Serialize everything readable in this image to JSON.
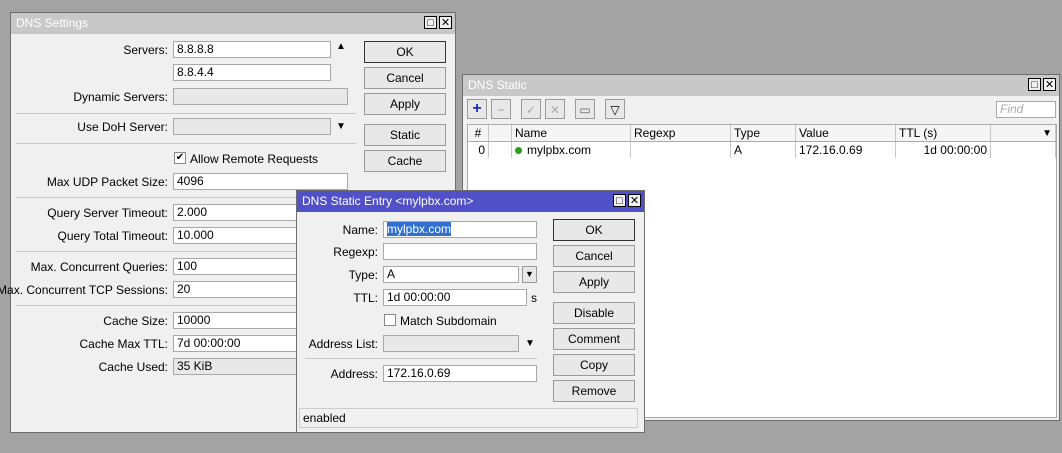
{
  "settings": {
    "title": "DNS Settings",
    "labels": {
      "servers": "Servers:",
      "dynamic": "Dynamic Servers:",
      "doh": "Use DoH Server:",
      "udp": "Max UDP Packet Size:",
      "qst": "Query Server Timeout:",
      "qtt": "Query Total Timeout:",
      "mcq": "Max. Concurrent Queries:",
      "mct": "Max. Concurrent TCP Sessions:",
      "cs": "Cache Size:",
      "cmt": "Cache Max TTL:",
      "cu": "Cache Used:"
    },
    "values": {
      "server1": "8.8.8.8",
      "server2": "8.8.4.4",
      "dynamic": "",
      "doh": "",
      "udp": "4096",
      "qst": "2.000",
      "qtt": "10.000",
      "mcq": "100",
      "mct": "20",
      "cs": "10000",
      "cmt": "7d 00:00:00",
      "cu": "35 KiB"
    },
    "allow_remote": "Allow Remote Requests",
    "buttons": {
      "ok": "OK",
      "cancel": "Cancel",
      "apply": "Apply",
      "static": "Static",
      "cache": "Cache"
    }
  },
  "static": {
    "title": "DNS Static",
    "find_placeholder": "Find",
    "columns": [
      "#",
      "",
      "Name",
      "Regexp",
      "Type",
      "Value",
      "TTL (s)"
    ],
    "rows": [
      {
        "num": "0",
        "name": "mylpbx.com",
        "regexp": "",
        "type": "A",
        "value": "172.16.0.69",
        "ttl": "1d 00:00:00"
      }
    ]
  },
  "entry": {
    "title": "DNS Static Entry <mylpbx.com>",
    "labels": {
      "name": "Name:",
      "regexp": "Regexp:",
      "type": "Type:",
      "ttl": "TTL:",
      "addrlist": "Address List:",
      "address": "Address:"
    },
    "values": {
      "name": "mylpbx.com",
      "regexp": "",
      "type": "A",
      "ttl": "1d 00:00:00",
      "ttl_unit": "s",
      "addrlist": "",
      "address": "172.16.0.69"
    },
    "match_subdomain": "Match Subdomain",
    "buttons": {
      "ok": "OK",
      "cancel": "Cancel",
      "apply": "Apply",
      "disable": "Disable",
      "comment": "Comment",
      "copy": "Copy",
      "remove": "Remove"
    },
    "status": "enabled"
  }
}
